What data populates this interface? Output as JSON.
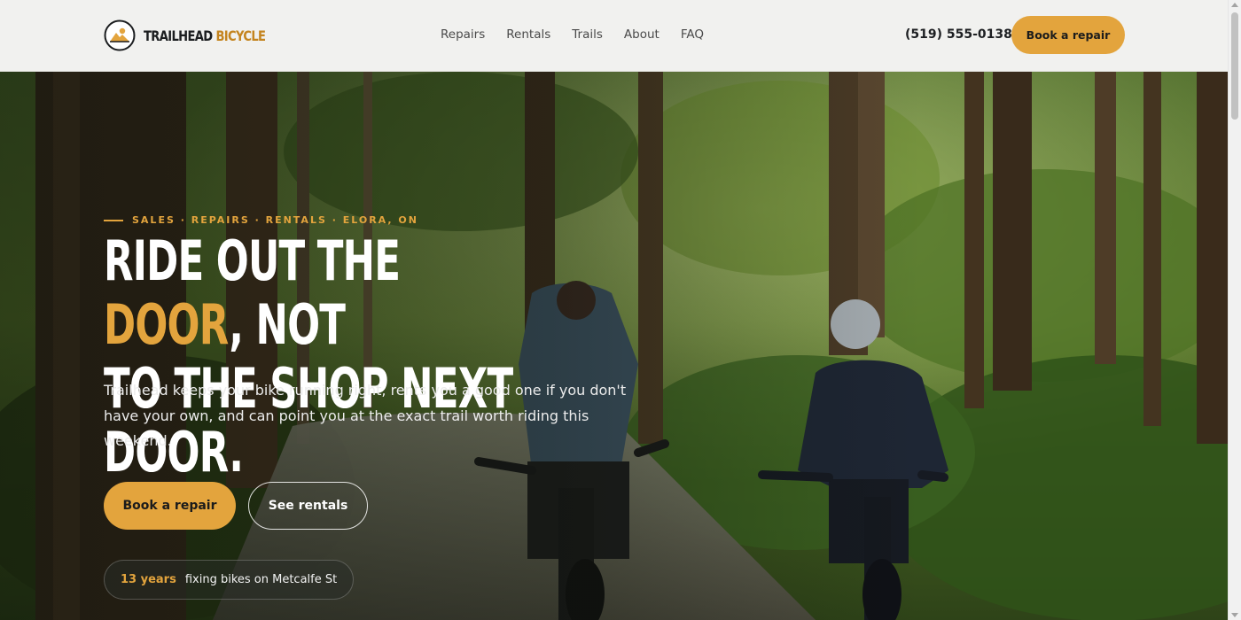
{
  "header": {
    "logo": {
      "word1": "TRAILHEAD",
      "word2": "BICYCLE",
      "icon": "mountain-sun-icon"
    },
    "nav": [
      {
        "label": "Repairs"
      },
      {
        "label": "Rentals"
      },
      {
        "label": "Trails"
      },
      {
        "label": "About"
      },
      {
        "label": "FAQ"
      }
    ],
    "phone": "(519) 555-0138",
    "cta_label": "Book a repair"
  },
  "hero": {
    "eyebrow": "SALES · REPAIRS · RENTALS · ELORA, ON",
    "headline_part1": "RIDE OUT THE ",
    "headline_accent": "DOOR",
    "headline_part2": ", NOT",
    "headline_line2": "TO THE SHOP NEXT DOOR.",
    "lede": "Trailhead keeps your bike running right, rents you a good one if you don't have your own, and can point you at the exact trail worth riding this weekend.",
    "primary_cta": "Book a repair",
    "secondary_cta": "See rentals",
    "badge": {
      "strong": "13 years",
      "text": "fixing bikes on Metcalfe St"
    }
  },
  "colors": {
    "accent": "#e3a43d",
    "header_bg": "#f1f1ef",
    "text_dark": "#1b1d1f",
    "logo_accent": "#c4841f"
  }
}
